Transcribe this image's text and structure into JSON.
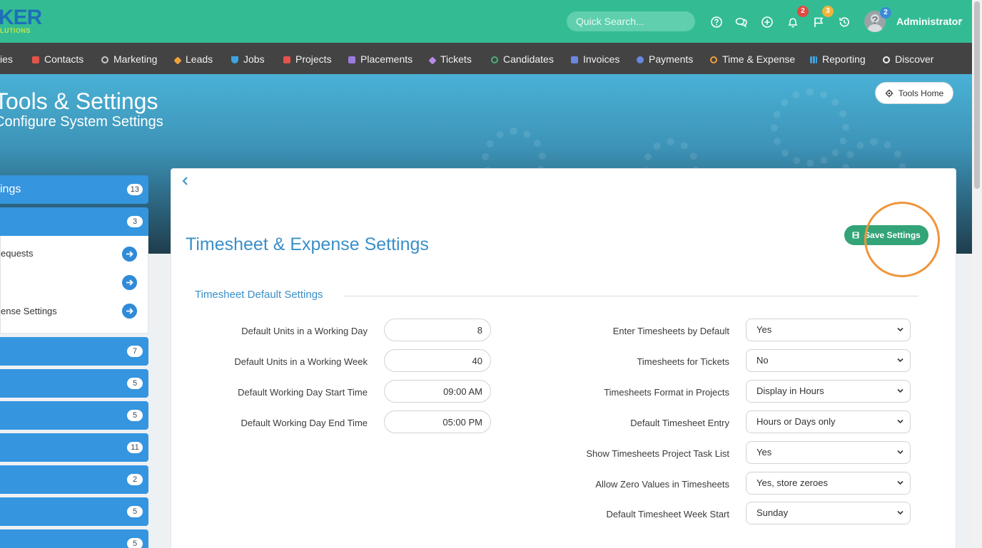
{
  "brand": {
    "logo_main": "KER",
    "logo_sub": "LUTIONS",
    "color_primary": "#33bc94",
    "color_nav": "#434343"
  },
  "header": {
    "search_placeholder": "Quick Search...",
    "notifications_count": "2",
    "flags_count": "3",
    "avatar_badge": "2",
    "user_name": "Administrator",
    "icons": [
      "help-icon",
      "chat-icon",
      "add-circle-icon",
      "bell-icon",
      "flag-icon",
      "history-icon"
    ]
  },
  "nav": {
    "items": [
      {
        "label": "ies",
        "icon": "companies-icon"
      },
      {
        "label": "Contacts",
        "icon": "contacts-icon"
      },
      {
        "label": "Marketing",
        "icon": "marketing-icon"
      },
      {
        "label": "Leads",
        "icon": "leads-icon"
      },
      {
        "label": "Jobs",
        "icon": "jobs-icon"
      },
      {
        "label": "Projects",
        "icon": "projects-icon"
      },
      {
        "label": "Placements",
        "icon": "placements-icon"
      },
      {
        "label": "Tickets",
        "icon": "tickets-icon"
      },
      {
        "label": "Candidates",
        "icon": "candidates-icon"
      },
      {
        "label": "Invoices",
        "icon": "invoices-icon"
      },
      {
        "label": "Payments",
        "icon": "payments-icon"
      },
      {
        "label": "Time & Expense",
        "icon": "clock-icon"
      },
      {
        "label": "Reporting",
        "icon": "chart-icon"
      },
      {
        "label": "Discover",
        "icon": "search-icon"
      }
    ]
  },
  "hero": {
    "title": "Tools & Settings",
    "subtitle": "Configure System Settings",
    "tools_home_label": "Tools Home"
  },
  "sidebar": {
    "groups": [
      {
        "label": "ings",
        "count": "13"
      },
      {
        "label": "",
        "count": "3"
      },
      {
        "label": "",
        "count": "7"
      },
      {
        "label": "",
        "count": "5"
      },
      {
        "label": "",
        "count": "5"
      },
      {
        "label": "",
        "count": "11"
      },
      {
        "label": "",
        "count": "2"
      },
      {
        "label": "",
        "count": "5"
      },
      {
        "label": "",
        "count": "5"
      }
    ],
    "sub_items": [
      {
        "label": "equests"
      },
      {
        "label": ""
      },
      {
        "label": "ense Settings"
      }
    ]
  },
  "main": {
    "title": "Timesheet & Expense Settings",
    "save_label": "Save Settings",
    "section_title": "Timesheet Default Settings",
    "left_fields": [
      {
        "label": "Default Units in a Working Day",
        "value": "8"
      },
      {
        "label": "Default Units in a Working Week",
        "value": "40"
      },
      {
        "label": "Default Working Day Start Time",
        "value": "09:00 AM"
      },
      {
        "label": "Default Working Day End Time",
        "value": "05:00 PM"
      }
    ],
    "right_fields": [
      {
        "label": "Enter Timesheets by Default",
        "value": "Yes"
      },
      {
        "label": "Timesheets for Tickets",
        "value": "No"
      },
      {
        "label": "Timesheets Format in Projects",
        "value": "Display in Hours"
      },
      {
        "label": "Default Timesheet Entry",
        "value": "Hours or Days only"
      },
      {
        "label": "Show Timesheets Project Task List",
        "value": "Yes"
      },
      {
        "label": "Allow Zero Values in Timesheets",
        "value": "Yes, store zeroes"
      },
      {
        "label": "Default Timesheet Week Start",
        "value": "Sunday"
      }
    ]
  }
}
